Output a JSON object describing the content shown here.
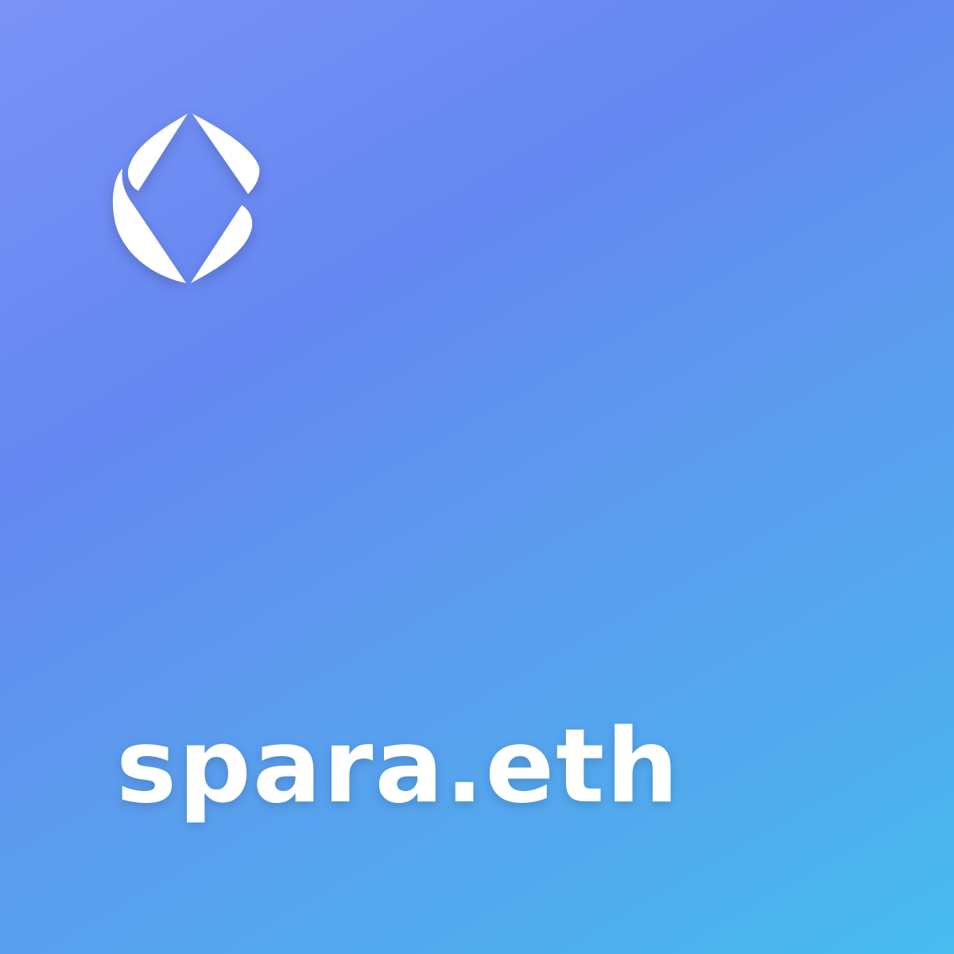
{
  "card": {
    "domain_name": "spara.eth",
    "logo_icon": "ens-logo-icon",
    "colors": {
      "gradient_start": "#7A92F6",
      "gradient_end": "#47BDEE",
      "text": "#FFFFFF"
    }
  }
}
